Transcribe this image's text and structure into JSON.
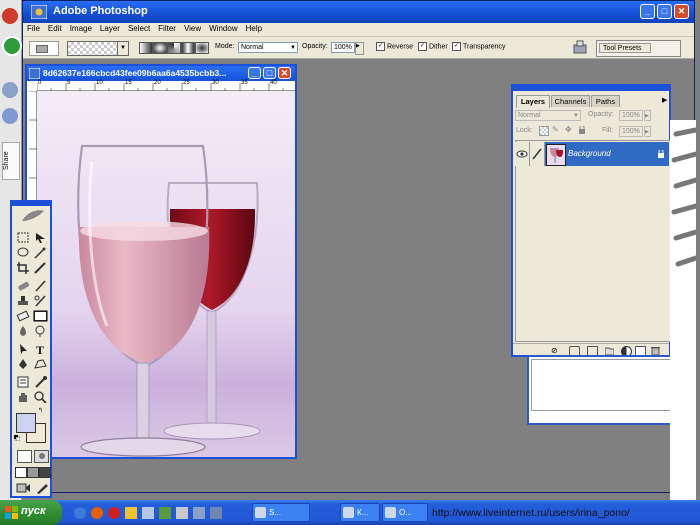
{
  "app": {
    "title": "Adobe Photoshop",
    "menu": [
      "File",
      "Edit",
      "Image",
      "Layer",
      "Select",
      "Filter",
      "View",
      "Window",
      "Help"
    ]
  },
  "options_bar": {
    "mode_label": "Mode:",
    "mode_value": "Normal",
    "opacity_label": "Opacity:",
    "opacity_value": "100%",
    "reverse_label": "Reverse",
    "dither_label": "Dither",
    "transparency_label": "Transparency",
    "tool_presets_label": "Tool Presets"
  },
  "document": {
    "title": "8d62637e166cbcd43fee09b6aa6a4535bcbb3...",
    "ruler_ticks": [
      "0",
      "5",
      "10",
      "15",
      "20",
      "25",
      "30",
      "35",
      "40",
      "45"
    ]
  },
  "layers_palette": {
    "tabs": [
      "Layers",
      "Channels",
      "Paths"
    ],
    "blend_mode": "Normal",
    "opacity_label": "Opacity:",
    "opacity_value": "100%",
    "lock_label": "Lock:",
    "fill_label": "Fill:",
    "fill_value": "100%",
    "layer_name": "Background"
  },
  "left_strip": {
    "share_label": "Share"
  },
  "taskbar": {
    "start_label": "пуск",
    "buttons": [
      "S...",
      "К...",
      "О..."
    ],
    "status_url": "http://www.liveinternet.ru/users/irina_pono/"
  },
  "colors": {
    "xp_blue": "#1552d8",
    "selected_layer": "#316ac5",
    "workspace": "#7f7f7f"
  }
}
